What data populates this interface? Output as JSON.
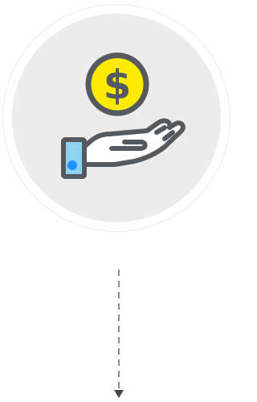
{
  "illustration": {
    "icon": "hand-holding-coin-icon",
    "coin_symbol": "$",
    "colors": {
      "disc_background": "#ececec",
      "outline": "#555a5f",
      "coin_fill": "#ffeb00",
      "cuff_fill": "#8fd3f0",
      "button_fill": "#1e90ff"
    }
  },
  "connector": {
    "icon": "dashed-arrow-down-icon",
    "color": "#444444"
  }
}
